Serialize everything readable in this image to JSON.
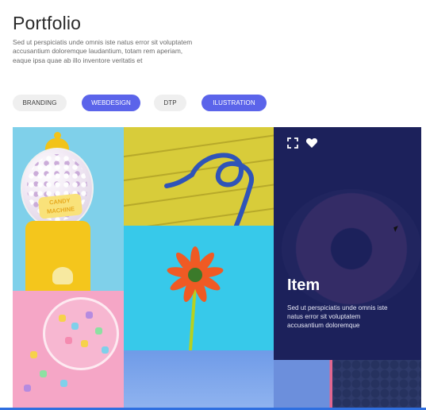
{
  "header": {
    "title": "Portfolio",
    "description": "Sed ut perspiciatis unde omnis iste natus error sit voluptatem accusantium doloremque laudantium, totam rem aperiam, eaque ipsa quae ab illo inventore veritatis et"
  },
  "filters": [
    {
      "label": "BRANDING",
      "active": false
    },
    {
      "label": "WEBDESIGN",
      "active": true
    },
    {
      "label": "DTP",
      "active": false
    },
    {
      "label": "ILUSTRATION",
      "active": true
    }
  ],
  "gallery": {
    "gumball_label": "CANDY MACHINE",
    "card": {
      "title": "Item",
      "description": "Sed ut perspiciatis unde omnis iste natus error sit voluptatem accusantium doloremque",
      "icons": [
        "expand-icon",
        "heart-icon"
      ]
    }
  },
  "colors": {
    "accent": "#5b64ea",
    "chip_inactive": "#efefef",
    "card_overlay": "#1f2563",
    "bottom_bar": "#2f6fe0"
  }
}
